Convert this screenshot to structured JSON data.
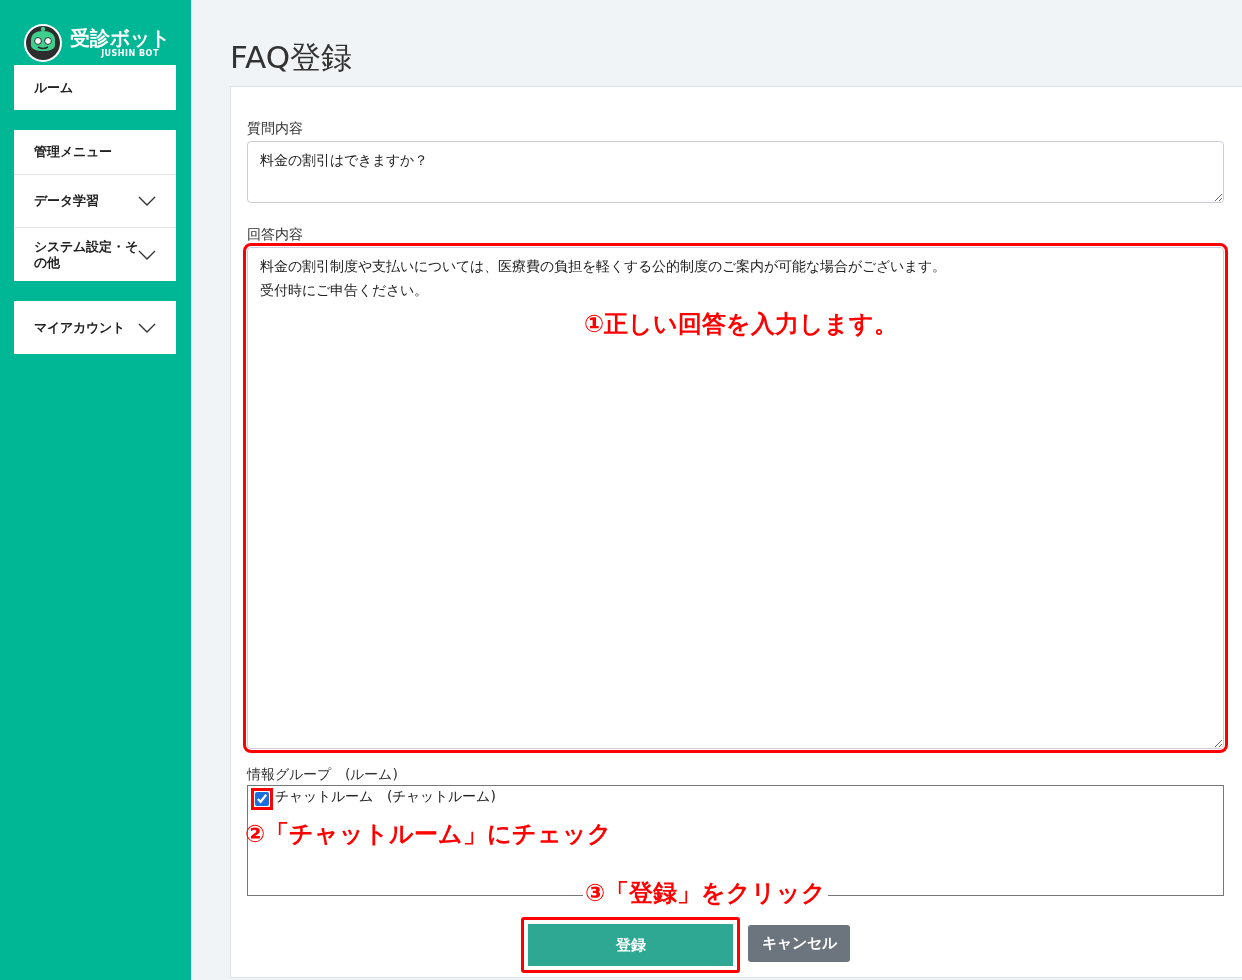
{
  "sidebar": {
    "logo": {
      "name": "受診ボット",
      "subtitle": "JUSHIN BOT"
    },
    "groups": [
      {
        "items": [
          {
            "label": "ルーム",
            "expandable": false
          }
        ]
      },
      {
        "items": [
          {
            "label": "管理メニュー",
            "expandable": false
          },
          {
            "label": "データ学習",
            "expandable": true
          },
          {
            "label": "システム設定・その他",
            "expandable": true
          }
        ]
      },
      {
        "items": [
          {
            "label": "マイアカウント",
            "expandable": true
          }
        ]
      }
    ]
  },
  "page": {
    "title": "FAQ登録"
  },
  "form": {
    "question": {
      "label": "質問内容",
      "value": "料金の割引はできますか？",
      "highlighted": false
    },
    "answer": {
      "label": "回答内容",
      "lines": [
        "料金の割引制度や支払いについては、医療費の負担を軽くする公的制度のご案内が可能な場合がございます。",
        "受付時にご申告ください。"
      ],
      "highlighted": true,
      "annotation": "①正しい回答を入力します。"
    },
    "group": {
      "label": "情報グループ　(ルーム)",
      "options": [
        {
          "label": "チャットルーム　(チャットルーム)",
          "checked": true,
          "highlighted": true
        }
      ],
      "annotation": "②「チャットルーム」にチェック"
    },
    "buttons_annotation": "③「登録」をクリック",
    "buttons": [
      {
        "label": "登録",
        "kind": "primary",
        "highlighted": true
      },
      {
        "label": "キャンセル",
        "kind": "secondary",
        "highlighted": false
      }
    ]
  }
}
